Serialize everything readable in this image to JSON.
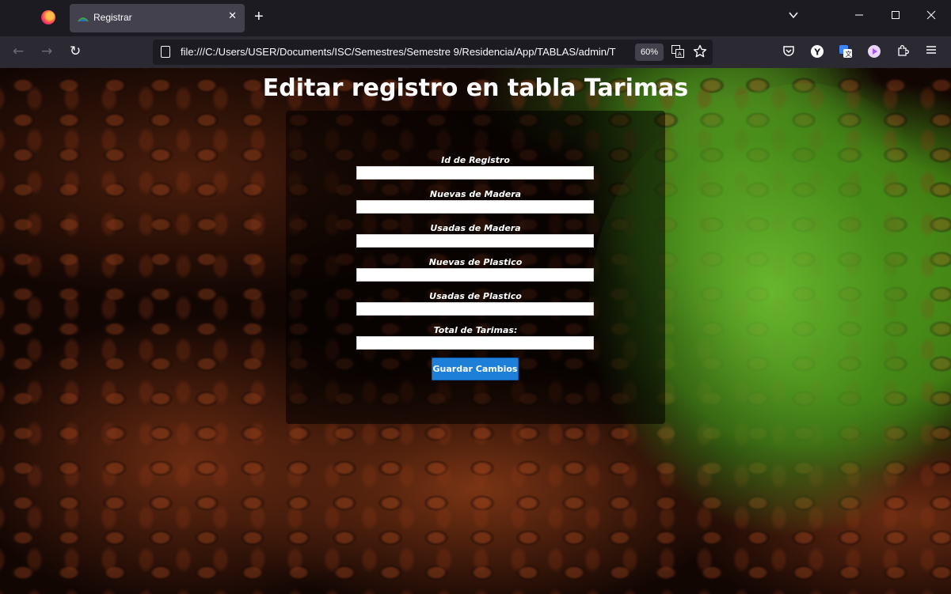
{
  "browser": {
    "tab_title": "Registrar",
    "url": "file:///C:/Users/USER/Documents/ISC/Semestres/Semestre 9/Residencia/App/TABLAS/admin/T",
    "zoom": "60%"
  },
  "page": {
    "title": "Editar registro en tabla Tarimas",
    "fields": [
      {
        "label": "Id de Registro",
        "value": ""
      },
      {
        "label": "Nuevas de Madera",
        "value": ""
      },
      {
        "label": "Usadas de Madera",
        "value": ""
      },
      {
        "label": "Nuevas de Plastico",
        "value": ""
      },
      {
        "label": "Usadas de Plastico",
        "value": ""
      },
      {
        "label": "Total de Tarimas:",
        "value": ""
      }
    ],
    "submit_label": "Guardar Cambios"
  },
  "colors": {
    "button": "#1e7fd8",
    "panel": "rgba(0,0,0,0.55)",
    "chrome_dark": "#1c1b22",
    "chrome_toolbar": "#2b2a33"
  }
}
